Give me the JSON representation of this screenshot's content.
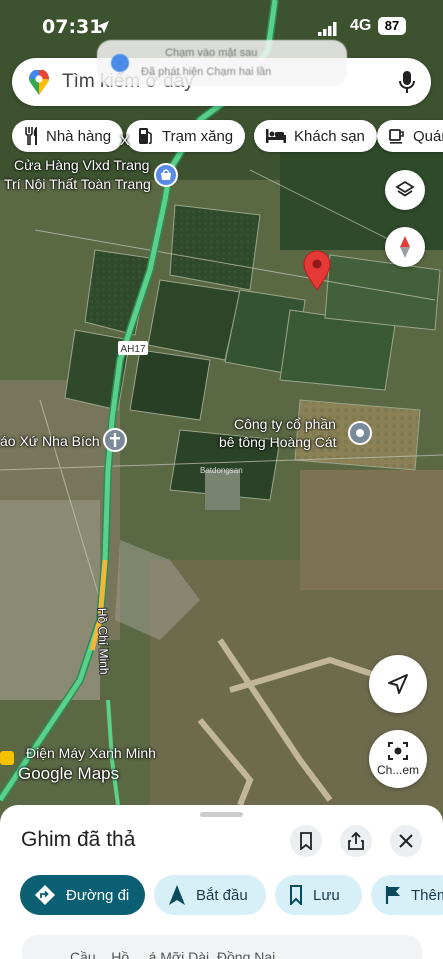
{
  "status_bar": {
    "time": "07:31",
    "network": "4G",
    "battery": "87"
  },
  "toast": {
    "title": "Chạm vào mặt sau",
    "subtitle": "Đã phát hiện Chạm hai lần"
  },
  "search": {
    "placeholder": "Tìm kiếm ở đây"
  },
  "chips": [
    {
      "label": "Nhà hàng",
      "icon": "fork-knife-icon"
    },
    {
      "label": "Trạm xăng",
      "icon": "gas-pump-icon"
    },
    {
      "label": "Khách sạn",
      "icon": "bed-icon"
    },
    {
      "label": "Quán",
      "icon": "coffee-cup-icon"
    }
  ],
  "map": {
    "labels": {
      "shop_line1": "Cửa Hàng Vlxd Trang",
      "shop_line2": "Trí Nội Thất Toàn Trang",
      "church": "áo Xứ Nha Bích",
      "company_line1": "Công ty cổ phần",
      "company_line2": "bê tông Hoàng Cát",
      "highway_badge": "AH17",
      "road_name": "Hồ Chí Minh",
      "electronics": "Điện Máy Xanh Minh",
      "watermark": "Batdongsan",
      "brand": "Google Maps",
      "partial_x": "X"
    },
    "colors": {
      "road": "#59d18a",
      "pin": "#e53935",
      "compass_red": "#e53935"
    }
  },
  "fabs": {
    "layers_icon": "layers-icon",
    "compass_icon": "compass-icon",
    "location_icon": "navigation-arrow-icon",
    "lens_label": "Ch...em"
  },
  "sheet": {
    "title": "Ghim đã thả",
    "actions": [
      {
        "label": "Đường đi",
        "icon": "directions-icon",
        "primary": true
      },
      {
        "label": "Bắt đầu",
        "icon": "navigation-icon",
        "primary": false
      },
      {
        "label": "Lưu",
        "icon": "bookmark-icon",
        "primary": false
      },
      {
        "label": "Thêm",
        "icon": "flag-icon",
        "primary": false
      }
    ],
    "address": "Cầu... Hồ ... á Mỡi Dài, Đồng Nai"
  }
}
